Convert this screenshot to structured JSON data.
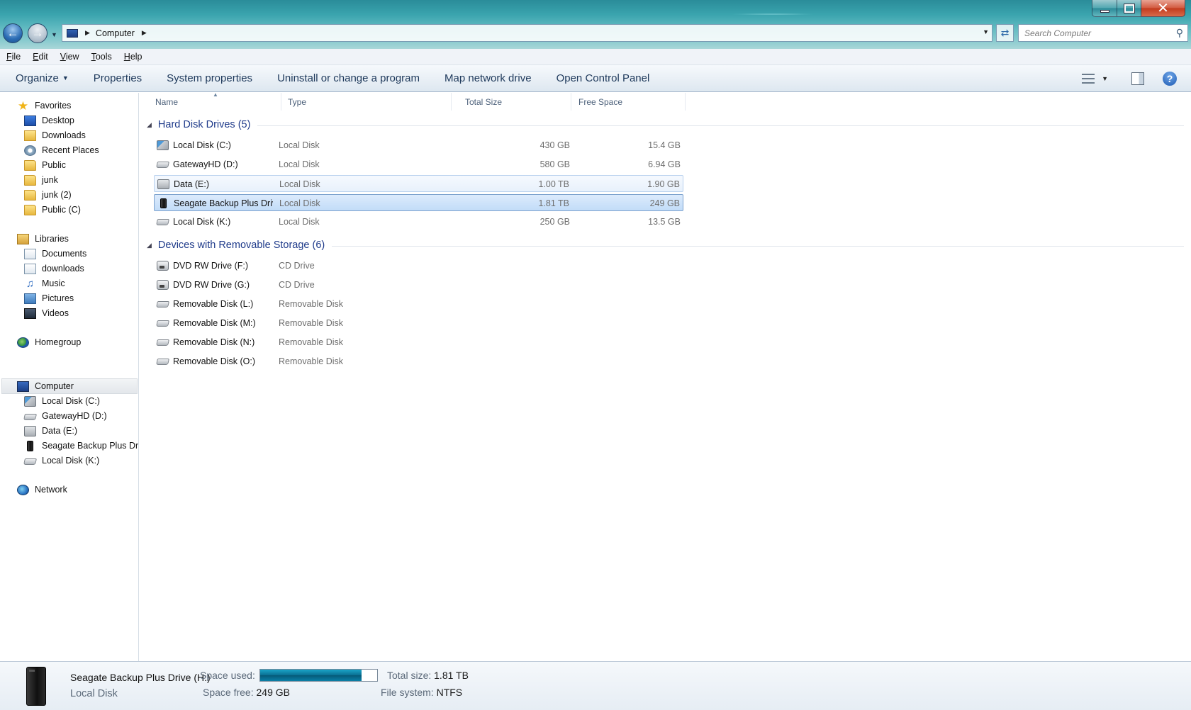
{
  "window": {
    "min": "",
    "max": "",
    "close": "✕"
  },
  "address": {
    "crumb": "Computer",
    "search_placeholder": "Search Computer"
  },
  "menu": [
    "File",
    "Edit",
    "View",
    "Tools",
    "Help"
  ],
  "menu_underline": [
    "F",
    "E",
    "V",
    "T",
    "H"
  ],
  "toolbar": {
    "organize": "Organize",
    "properties": "Properties",
    "system_properties": "System properties",
    "uninstall": "Uninstall or change a program",
    "map_drive": "Map network drive",
    "control_panel": "Open Control Panel",
    "help": "?"
  },
  "nav": {
    "favorites": "Favorites",
    "fav_items": [
      "Desktop",
      "Downloads",
      "Recent Places",
      "Public",
      "junk",
      "junk (2)",
      "Public (C)"
    ],
    "libraries": "Libraries",
    "lib_items": [
      "Documents",
      "downloads",
      "Music",
      "Pictures",
      "Videos"
    ],
    "homegroup": "Homegroup",
    "computer": "Computer",
    "comp_items": [
      "Local Disk (C:)",
      "GatewayHD (D:)",
      "Data (E:)",
      "Seagate Backup Plus Drive",
      "Local Disk (K:)"
    ],
    "network": "Network"
  },
  "columns": {
    "name": "Name",
    "type": "Type",
    "total": "Total Size",
    "free": "Free Space"
  },
  "groups": {
    "hdd": "Hard Disk Drives (5)",
    "removable": "Devices with Removable Storage (6)"
  },
  "hdd_rows": [
    {
      "name": "Local Disk (C:)",
      "type": "Local Disk",
      "total": "430 GB",
      "free": "15.4 GB"
    },
    {
      "name": "GatewayHD (D:)",
      "type": "Local Disk",
      "total": "580 GB",
      "free": "6.94 GB"
    },
    {
      "name": "Data (E:)",
      "type": "Local Disk",
      "total": "1.00 TB",
      "free": "1.90 GB"
    },
    {
      "name": "Seagate Backup Plus Driv...",
      "type": "Local Disk",
      "total": "1.81 TB",
      "free": "249 GB"
    },
    {
      "name": "Local Disk (K:)",
      "type": "Local Disk",
      "total": "250 GB",
      "free": "13.5 GB"
    }
  ],
  "removable_rows": [
    {
      "name": "DVD RW Drive (F:)",
      "type": "CD Drive"
    },
    {
      "name": "DVD RW Drive (G:)",
      "type": "CD Drive"
    },
    {
      "name": "Removable Disk (L:)",
      "type": "Removable Disk"
    },
    {
      "name": "Removable Disk (M:)",
      "type": "Removable Disk"
    },
    {
      "name": "Removable Disk (N:)",
      "type": "Removable Disk"
    },
    {
      "name": "Removable Disk (O:)",
      "type": "Removable Disk"
    }
  ],
  "details": {
    "name": "Seagate Backup Plus Drive (H:)",
    "type": "Local Disk",
    "space_used_label": "Space used:",
    "space_used_fraction": 0.866,
    "space_free_label": "Space free:",
    "space_free": "249 GB",
    "total_size_label": "Total size:",
    "total_size": "1.81 TB",
    "file_system_label": "File system:",
    "file_system": "NTFS"
  },
  "colors": {
    "accent": "#1e3a8a",
    "selection": "#c2dcf8",
    "usage_bar": "#0a6f92"
  }
}
